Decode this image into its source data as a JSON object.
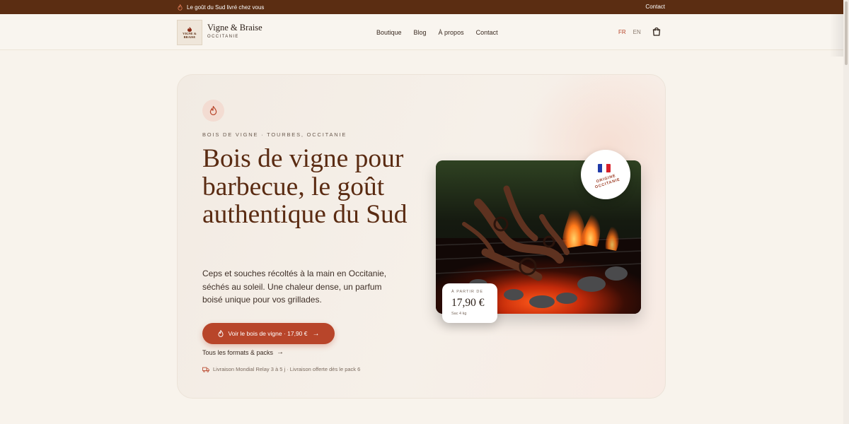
{
  "topbar": {
    "message": "Le goût du Sud livré chez vous",
    "contact_label": "Contact"
  },
  "header": {
    "brand_name": "Vigne & Braise",
    "brand_sub": "OCCITANIE",
    "logo_lines": [
      "VIGNE &",
      "BRAISE"
    ],
    "nav": [
      "Boutique",
      "Blog",
      "À propos",
      "Contact"
    ],
    "lang_fr": "FR",
    "lang_en": "EN"
  },
  "hero": {
    "eyebrow": "BOIS DE VIGNE · TOURBES, OCCITANIE",
    "headline": "Bois de vigne pour barbecue, le goût authentique du Sud",
    "lead": "Ceps et souches récoltés à la main en Occitanie, séchés au soleil. Une chaleur dense, un parfum boisé unique pour vos grillades.",
    "cta_label": "Voir le bois de vigne · 17,90 €",
    "secondary_link": "Tous les formats & packs",
    "delivery": "Livraison Mondial Relay 3 à 5 j · Livraison offerte dès le pack 6"
  },
  "badge": {
    "line1": "ORIGINE",
    "line2": "OCCITANIE"
  },
  "price_card": {
    "from_label": "À PARTIR DE",
    "price": "17,90 €",
    "size": "Sac 4 kg"
  },
  "colors": {
    "topbar": "#5b2d12",
    "accent": "#b8452a",
    "headline": "#5a2b12",
    "background": "#f8f3ec"
  },
  "icons": {
    "flame": "flame-icon",
    "cart": "cart-icon",
    "arrow": "arrow-right-icon",
    "truck": "truck-icon",
    "flag": "france-flag-icon"
  }
}
